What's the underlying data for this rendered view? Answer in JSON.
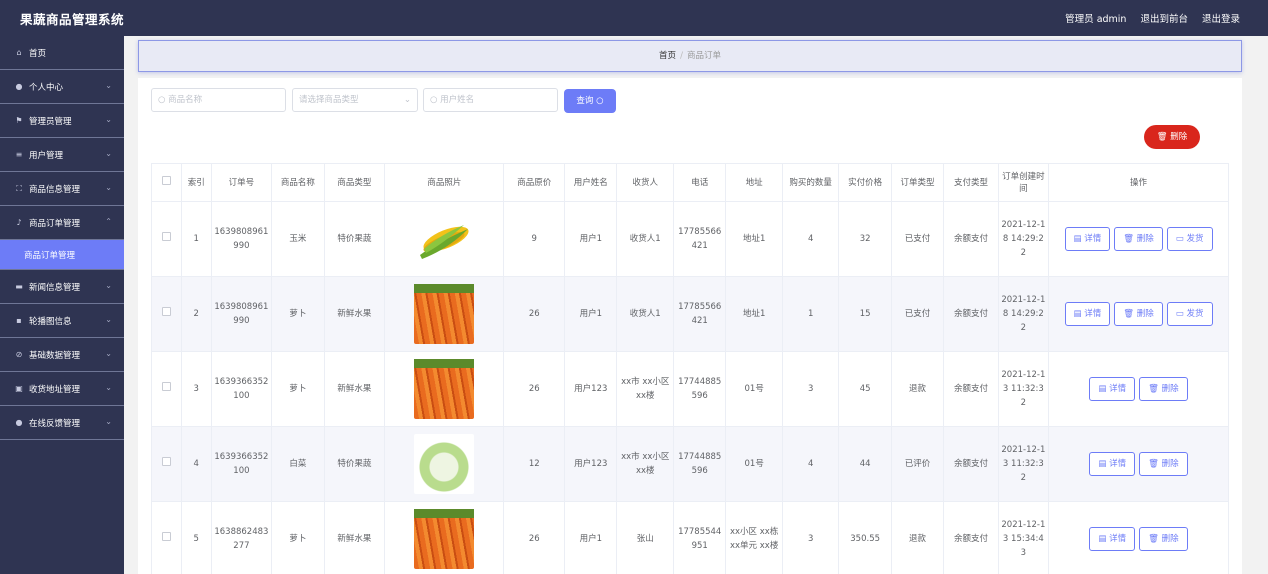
{
  "header": {
    "title": "果蔬商品管理系统",
    "admin": "管理员 admin",
    "to_front": "退出到前台",
    "logout": "退出登录"
  },
  "sidebar": {
    "items": [
      {
        "label": "首页",
        "icon": "home-icon"
      },
      {
        "label": "个人中心",
        "icon": "user-icon"
      },
      {
        "label": "管理员管理",
        "icon": "flag-icon"
      },
      {
        "label": "用户管理",
        "icon": "sliders-icon"
      },
      {
        "label": "商品信息管理",
        "icon": "expand-icon"
      },
      {
        "label": "商品订单管理",
        "icon": "mic-icon"
      },
      {
        "label": "商品订单管理",
        "icon": ""
      },
      {
        "label": "新闻信息管理",
        "icon": "news-icon"
      },
      {
        "label": "轮播图信息",
        "icon": "message-icon"
      },
      {
        "label": "基础数据管理",
        "icon": "stamp-icon"
      },
      {
        "label": "收货地址管理",
        "icon": "box-icon"
      },
      {
        "label": "在线反馈管理",
        "icon": "user-icon"
      }
    ]
  },
  "breadcrumb": {
    "home": "首页",
    "sep": "/",
    "current": "商品订单"
  },
  "search": {
    "name_placeholder": "商品名称",
    "type_placeholder": "请选择商品类型",
    "user_placeholder": "用户姓名",
    "query_label": "查询",
    "delete_label": "删除"
  },
  "table": {
    "headers": [
      "索引",
      "订单号",
      "商品名称",
      "商品类型",
      "商品照片",
      "商品原价",
      "用户姓名",
      "收货人",
      "电话",
      "地址",
      "购买的数量",
      "实付价格",
      "订单类型",
      "支付类型",
      "订单创建时间",
      "操作"
    ],
    "rows": [
      {
        "index": "1",
        "order_no": "1639808961990",
        "name": "玉米",
        "type": "特价果蔬",
        "photo": "corn",
        "price": "9",
        "user": "用户1",
        "receiver": "收货人1",
        "phone": "17785566421",
        "address": "地址1",
        "qty": "4",
        "paid": "32",
        "status": "已支付",
        "pay": "余额支付",
        "time": "2021-12-18 14:29:22",
        "actions": [
          "详情",
          "删除",
          "发货"
        ]
      },
      {
        "index": "2",
        "order_no": "1639808961990",
        "name": "萝卜",
        "type": "新鲜水果",
        "photo": "carrot",
        "price": "26",
        "user": "用户1",
        "receiver": "收货人1",
        "phone": "17785566421",
        "address": "地址1",
        "qty": "1",
        "paid": "15",
        "status": "已支付",
        "pay": "余额支付",
        "time": "2021-12-18 14:29:22",
        "actions": [
          "详情",
          "删除",
          "发货"
        ]
      },
      {
        "index": "3",
        "order_no": "1639366352100",
        "name": "萝卜",
        "type": "新鲜水果",
        "photo": "carrot",
        "price": "26",
        "user": "用户123",
        "receiver": "xx市 xx小区 xx楼",
        "phone": "17744885596",
        "address": "01号",
        "qty": "3",
        "paid": "45",
        "status": "退款",
        "pay": "余额支付",
        "time": "2021-12-13 11:32:32",
        "actions": [
          "详情",
          "删除"
        ]
      },
      {
        "index": "4",
        "order_no": "1639366352100",
        "name": "白菜",
        "type": "特价果蔬",
        "photo": "cabbage",
        "price": "12",
        "user": "用户123",
        "receiver": "xx市 xx小区 xx楼",
        "phone": "17744885596",
        "address": "01号",
        "qty": "4",
        "paid": "44",
        "status": "已评价",
        "pay": "余额支付",
        "time": "2021-12-13 11:32:32",
        "actions": [
          "详情",
          "删除"
        ]
      },
      {
        "index": "5",
        "order_no": "1638862483277",
        "name": "萝卜",
        "type": "新鲜水果",
        "photo": "carrot",
        "price": "26",
        "user": "用户1",
        "receiver": "张山",
        "phone": "17785544951",
        "address": "xx小区 xx栋 xx单元 xx楼",
        "qty": "3",
        "paid": "350.55",
        "status": "退款",
        "pay": "余额支付",
        "time": "2021-12-13 15:34:43",
        "actions": [
          "详情",
          "删除"
        ]
      }
    ]
  },
  "colors": {
    "sidebar_bg": "#2f3452",
    "accent": "#6d7cf7",
    "danger": "#d9261c"
  }
}
